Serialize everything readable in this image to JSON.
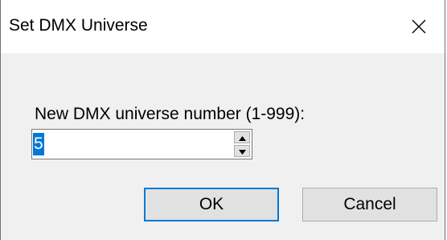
{
  "window": {
    "title": "Set DMX Universe",
    "close_icon": "close-icon"
  },
  "form": {
    "prompt": "New DMX universe number (1-999):",
    "universe_value": "5",
    "spin_up_icon": "arrow-up-icon",
    "spin_down_icon": "arrow-down-icon"
  },
  "buttons": {
    "ok_label": "OK",
    "cancel_label": "Cancel"
  },
  "colors": {
    "accent": "#0078d7",
    "dialog_background": "#f0f0f0",
    "title_background": "#ffffff",
    "button_face": "#e1e1e1"
  }
}
